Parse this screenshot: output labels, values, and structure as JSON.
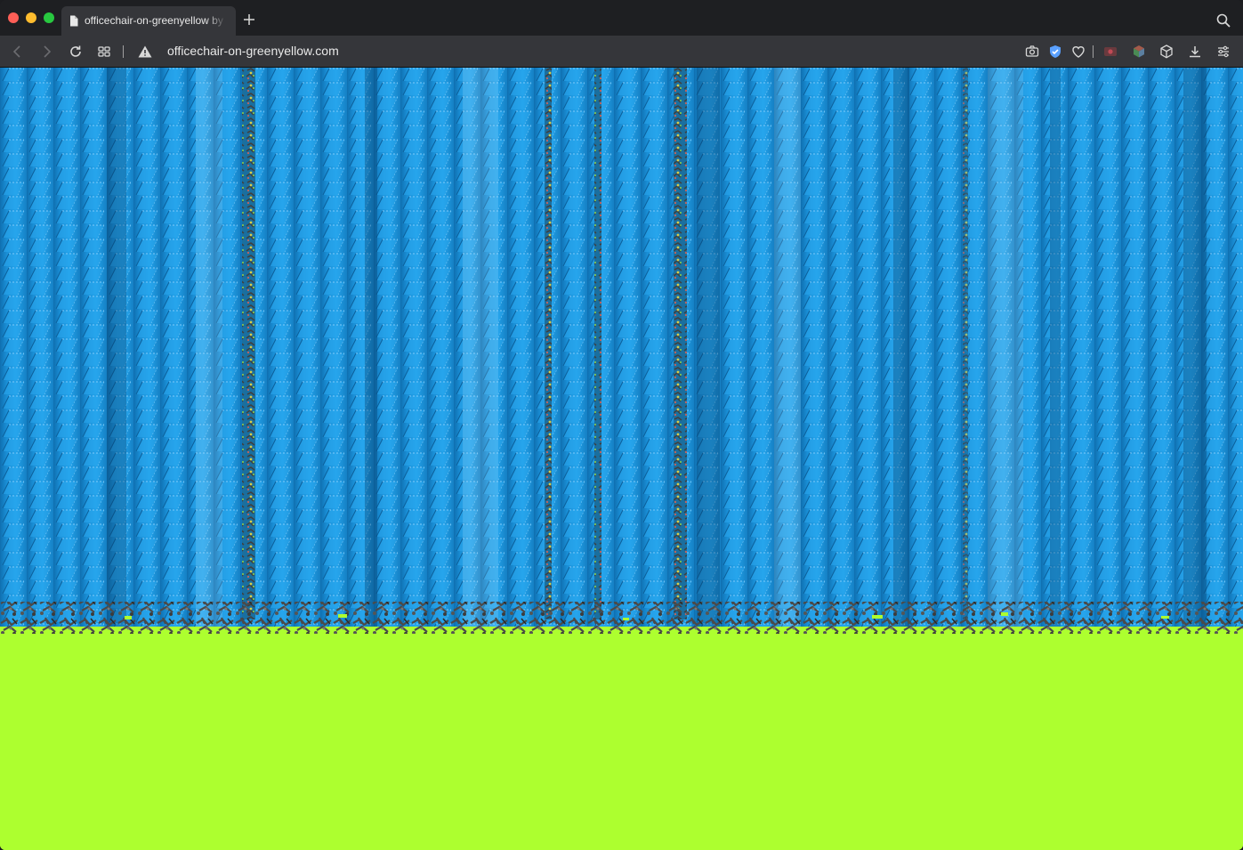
{
  "browser": {
    "tab_title": "officechair-on-greenyellow by E",
    "url": "officechair-on-greenyellow.com"
  },
  "icons": {
    "tab": "document-icon",
    "new_tab": "plus-icon",
    "search": "search-icon",
    "back": "chevron-left-icon",
    "forward": "chevron-right-icon",
    "reload": "reload-icon",
    "grid": "grid-icon",
    "security": "warning-icon",
    "camera": "camera-icon",
    "shield": "shield-icon",
    "heart": "heart-icon",
    "record": "record-icon",
    "color_cube": "cube-color-icon",
    "cube": "cube-icon",
    "download": "download-icon",
    "settings": "sliders-icon"
  },
  "colors": {
    "background": "#adff2f",
    "chair": "#1b95d9",
    "legs": "#4a4a4a",
    "highlight_stripe": "#e0d44a"
  }
}
